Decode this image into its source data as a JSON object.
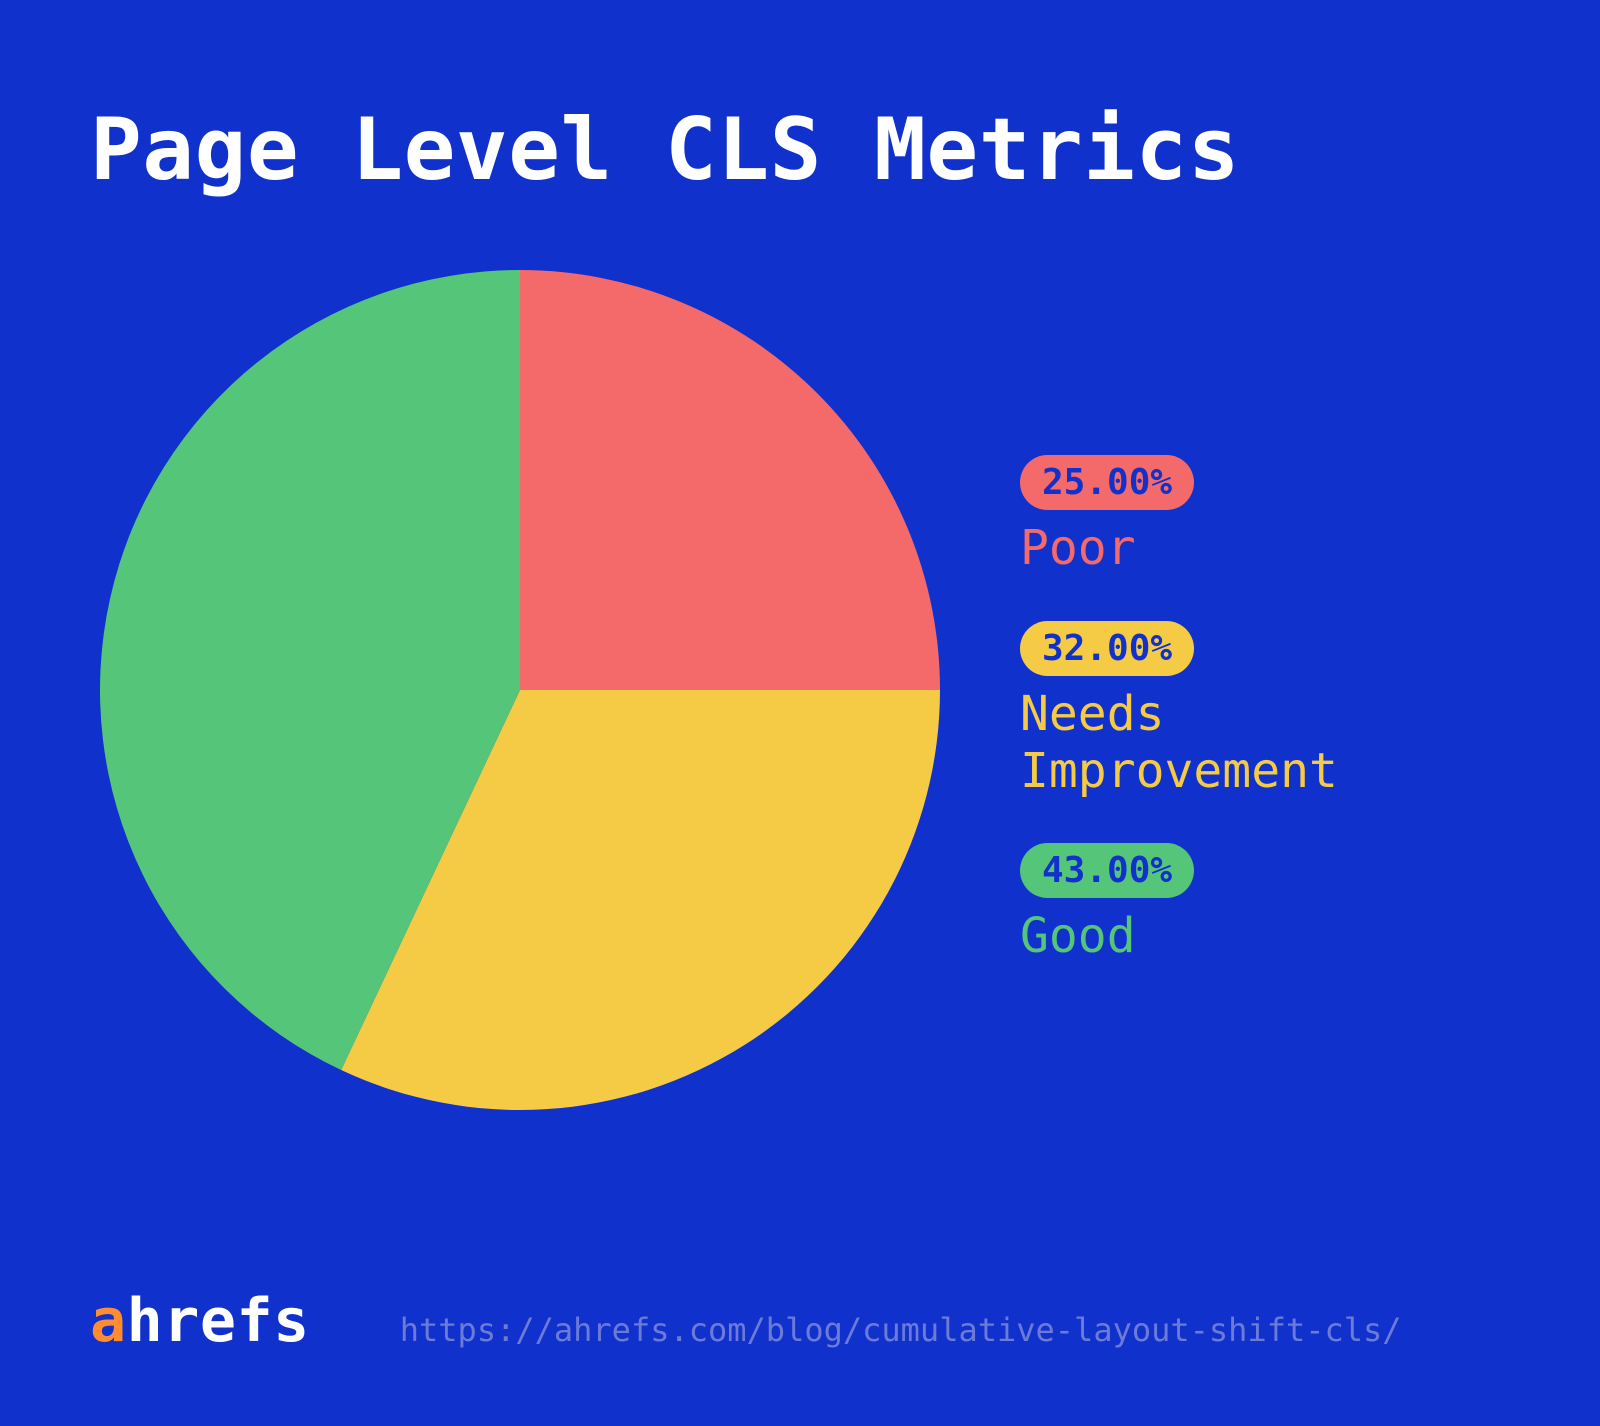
{
  "title": "Page Level CLS Metrics",
  "chart_data": {
    "type": "pie",
    "title": "Page Level CLS Metrics",
    "categories": [
      "Poor",
      "Needs Improvement",
      "Good"
    ],
    "values": [
      25.0,
      32.0,
      43.0
    ],
    "colors": [
      "#F46A6A",
      "#F5CB46",
      "#55C57A"
    ],
    "start_angle_deg": 0,
    "direction": "clockwise"
  },
  "legend": {
    "poor": {
      "pct": "25.00%",
      "label": "Poor",
      "color": "#F46A6A"
    },
    "needs": {
      "pct": "32.00%",
      "label": "Needs\nImprovement",
      "color": "#F5CB46"
    },
    "good": {
      "pct": "43.00%",
      "label": "Good",
      "color": "#55C57A"
    }
  },
  "logo": {
    "accent": "a",
    "rest": "hrefs"
  },
  "source_url": "https://ahrefs.com/blog/cumulative-layout-shift-cls/"
}
